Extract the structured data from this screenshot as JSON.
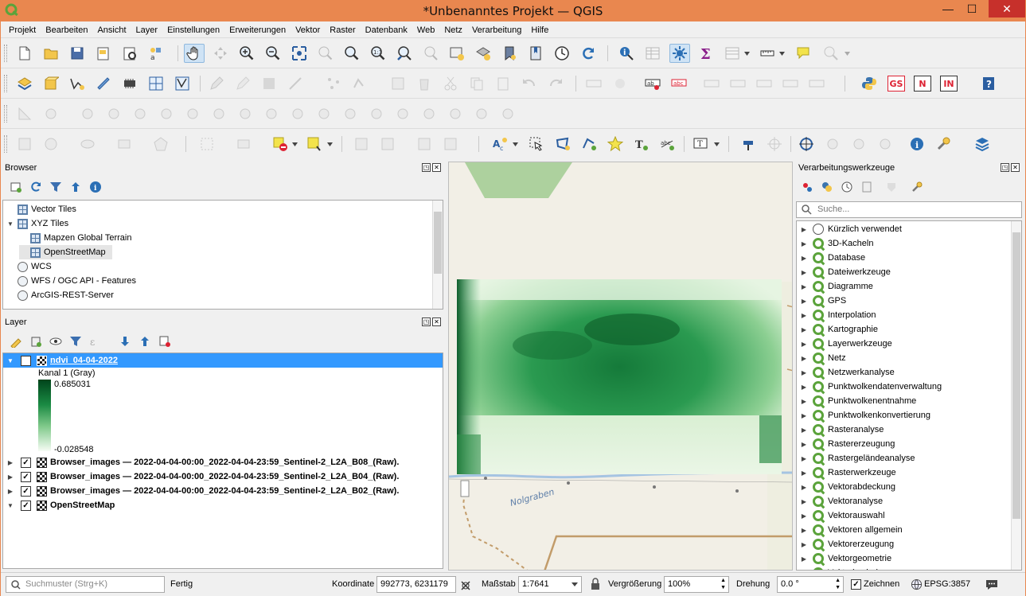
{
  "window": {
    "title": "*Unbenanntes Projekt — QGIS",
    "controls": {
      "minimize": "—",
      "maximize": "☐",
      "close": "✕"
    }
  },
  "menubar": [
    "Projekt",
    "Bearbeiten",
    "Ansicht",
    "Layer",
    "Einstellungen",
    "Erweiterungen",
    "Vektor",
    "Raster",
    "Datenbank",
    "Web",
    "Netz",
    "Verarbeitung",
    "Hilfe"
  ],
  "toolbar_text_buttons": {
    "gs": "GS",
    "n": "N",
    "in": "IN"
  },
  "browser": {
    "title": "Browser",
    "items": [
      {
        "label": "Vector Tiles",
        "icon": "grid-icon"
      },
      {
        "label": "XYZ Tiles",
        "icon": "grid-icon",
        "expanded": true
      },
      {
        "label": "Mapzen Global Terrain",
        "icon": "grid-icon"
      },
      {
        "label": "OpenStreetMap",
        "icon": "grid-icon",
        "selected": true
      },
      {
        "label": "WCS",
        "icon": "globe-icon"
      },
      {
        "label": "WFS / OGC API - Features",
        "icon": "globe-icon"
      },
      {
        "label": "ArcGIS-REST-Server",
        "icon": "globe-icon"
      }
    ]
  },
  "layers": {
    "title": "Layer",
    "selected_layer": "ndvi_04-04-2022",
    "band_label": "Kanal 1 (Gray)",
    "legend_max": "0.685031",
    "legend_min": "-0.028548",
    "others": [
      "Browser_images — 2022-04-04-00:00_2022-04-04-23:59_Sentinel-2_L2A_B08_(Raw).",
      "Browser_images — 2022-04-04-00:00_2022-04-04-23:59_Sentinel-2_L2A_B04_(Raw).",
      "Browser_images — 2022-04-04-00:00_2022-04-04-23:59_Sentinel-2_L2A_B02_(Raw).",
      "OpenStreetMap"
    ]
  },
  "map": {
    "river_label": "Nolgraben"
  },
  "processing": {
    "title": "Verarbeitungswerkzeuge",
    "search_placeholder": "Suche...",
    "items": [
      "Kürzlich verwendet",
      "3D-Kacheln",
      "Database",
      "Dateiwerkzeuge",
      "Diagramme",
      "GPS",
      "Interpolation",
      "Kartographie",
      "Layerwerkzeuge",
      "Netz",
      "Netzwerkanalyse",
      "Punktwolkendatenverwaltung",
      "Punktwolkenentnahme",
      "Punktwolkenkonvertierung",
      "Rasteranalyse",
      "Rastererzeugung",
      "Rastergeländeanalyse",
      "Rasterwerkzeuge",
      "Vektorabdeckung",
      "Vektoranalyse",
      "Vektorauswahl",
      "Vektoren allgemein",
      "Vektorerzeugung",
      "Vektorgeometrie",
      "Vektorkacheln"
    ]
  },
  "status": {
    "search_placeholder": "Suchmuster (Strg+K)",
    "message": "Fertig",
    "coord_label": "Koordinate",
    "coord_value": "992773, 6231179",
    "scale_label": "Maßstab",
    "scale_value": "1:7641",
    "magnifier_label": "Vergrößerung",
    "magnifier_value": "100%",
    "rotation_label": "Drehung",
    "rotation_value": "0.0 °",
    "render_label": "Zeichnen",
    "crs": "EPSG:3857"
  },
  "colors": {
    "titlebar": "#e9874f",
    "selection": "#3399ff",
    "ndvi_dark": "#00441b",
    "ndvi_light": "#f7fcf5",
    "osm_bg": "#f2efe6"
  }
}
